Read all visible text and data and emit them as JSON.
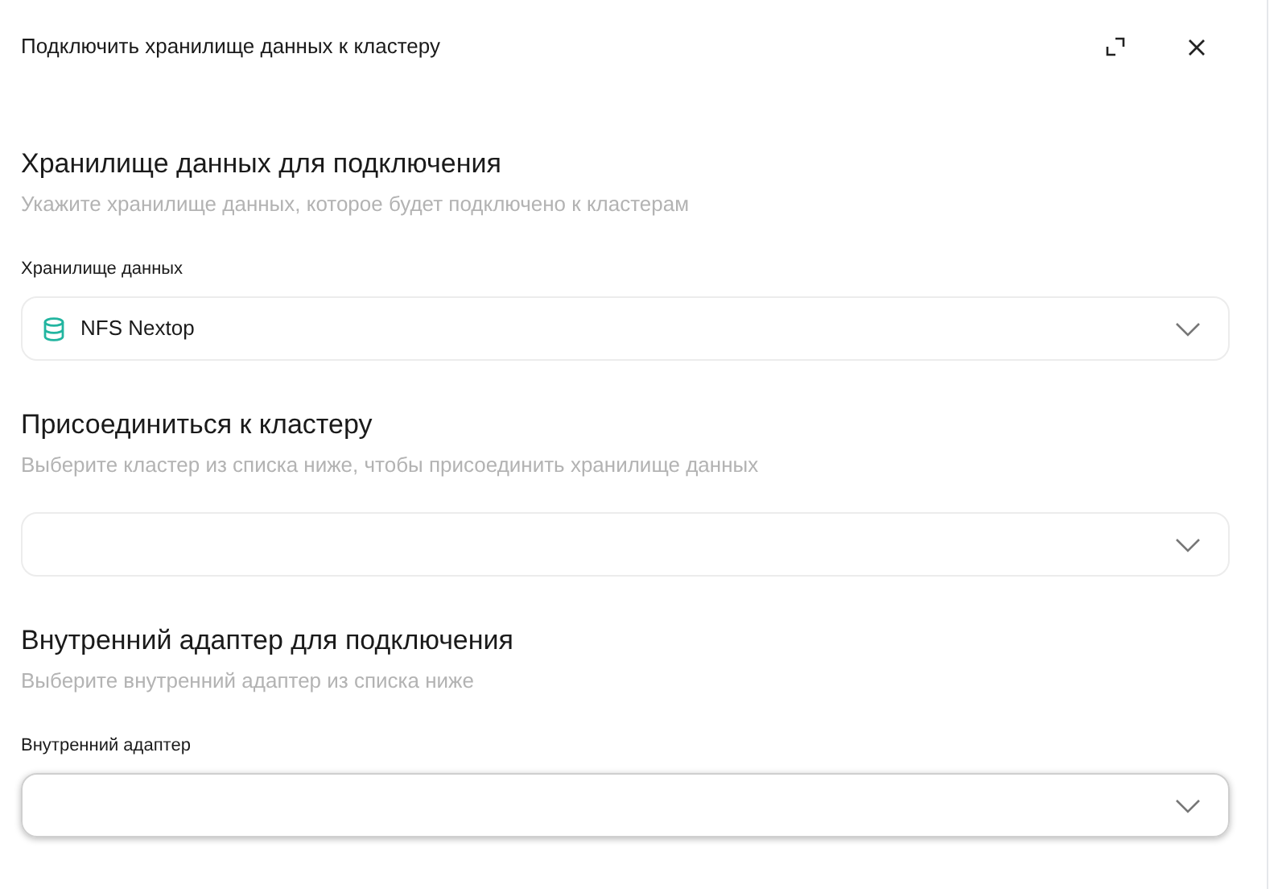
{
  "dialog": {
    "title": "Подключить хранилище данных к кластеру"
  },
  "sections": [
    {
      "heading": "Хранилище данных для подключения",
      "description": "Укажите хранилище данных, которое будет подключено к кластерам",
      "field": {
        "label": "Хранилище данных",
        "value": "NFS Nextop",
        "kind": "storage",
        "focused": false
      }
    },
    {
      "heading": "Присоединиться к кластеру",
      "description": "Выберите кластер из списка ниже, чтобы присоединить хранилище данных",
      "field": {
        "focused": false
      }
    },
    {
      "heading": "Внутренний адаптер для подключения",
      "description": "Выберите внутренний адаптер из списка ниже",
      "field": {
        "label": "Внутренний адаптер",
        "focused": true
      }
    }
  ]
}
